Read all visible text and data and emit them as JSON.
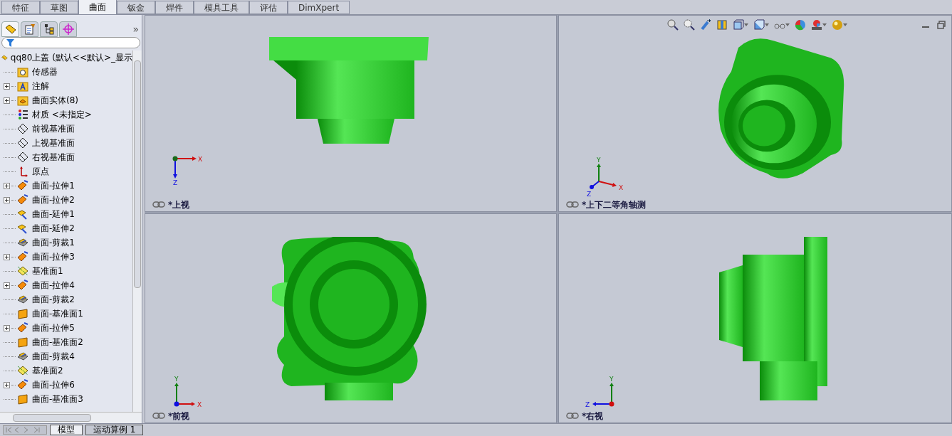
{
  "command_tabs": [
    {
      "label": "特征",
      "selected": false
    },
    {
      "label": "草图",
      "selected": false
    },
    {
      "label": "曲面",
      "selected": true
    },
    {
      "label": "钣金",
      "selected": false
    },
    {
      "label": "焊件",
      "selected": false
    },
    {
      "label": "模具工具",
      "selected": false
    },
    {
      "label": "评估",
      "selected": false
    },
    {
      "label": "DimXpert",
      "selected": false
    }
  ],
  "panel_tabs": [
    {
      "kind": "feature",
      "selected": true
    },
    {
      "kind": "property",
      "selected": false
    },
    {
      "kind": "config",
      "selected": false
    },
    {
      "kind": "target",
      "selected": false
    }
  ],
  "panel_more": "»",
  "tree": {
    "root": "qq80上盖  (默认<<默认>_显示",
    "items": [
      {
        "label": "传感器",
        "kind": "sensor",
        "expandable": false
      },
      {
        "label": "注解",
        "kind": "annotation",
        "expandable": true
      },
      {
        "label": "曲面实体(8)",
        "kind": "bodies",
        "expandable": true
      },
      {
        "label": "材质 <未指定>",
        "kind": "material",
        "expandable": false
      },
      {
        "label": "前视基准面",
        "kind": "plane",
        "expandable": false
      },
      {
        "label": "上视基准面",
        "kind": "plane",
        "expandable": false
      },
      {
        "label": "右视基准面",
        "kind": "plane",
        "expandable": false
      },
      {
        "label": "原点",
        "kind": "origin",
        "expandable": false
      },
      {
        "label": "曲面-拉伸1",
        "kind": "extrude",
        "expandable": true
      },
      {
        "label": "曲面-拉伸2",
        "kind": "extrude",
        "expandable": true
      },
      {
        "label": "曲面-延伸1",
        "kind": "extend",
        "expandable": false
      },
      {
        "label": "曲面-延伸2",
        "kind": "extend",
        "expandable": false
      },
      {
        "label": "曲面-剪裁1",
        "kind": "trim",
        "expandable": false
      },
      {
        "label": "曲面-拉伸3",
        "kind": "extrude",
        "expandable": true
      },
      {
        "label": "基准面1",
        "kind": "refplane",
        "expandable": false
      },
      {
        "label": "曲面-拉伸4",
        "kind": "extrude",
        "expandable": true
      },
      {
        "label": "曲面-剪裁2",
        "kind": "trim",
        "expandable": false
      },
      {
        "label": "曲面-基准面1",
        "kind": "planar",
        "expandable": false
      },
      {
        "label": "曲面-拉伸5",
        "kind": "extrude",
        "expandable": true
      },
      {
        "label": "曲面-基准面2",
        "kind": "planar",
        "expandable": false
      },
      {
        "label": "曲面-剪裁4",
        "kind": "trim",
        "expandable": false
      },
      {
        "label": "基准面2",
        "kind": "refplane",
        "expandable": false
      },
      {
        "label": "曲面-拉伸6",
        "kind": "extrude",
        "expandable": true
      },
      {
        "label": "曲面-基准面3",
        "kind": "planar",
        "expandable": false
      }
    ]
  },
  "bottom_tabs": [
    {
      "label": "模型",
      "selected": true
    },
    {
      "label": "运动算例 1",
      "selected": false
    }
  ],
  "viewports": [
    {
      "label": "*上视",
      "kind": "top",
      "axes": [
        "X",
        "Z"
      ]
    },
    {
      "label": "*上下二等角轴测",
      "kind": "iso",
      "axes": [
        "Y",
        "X",
        "Z"
      ]
    },
    {
      "label": "*前视",
      "kind": "front",
      "axes": [
        "Y",
        "X"
      ]
    },
    {
      "label": "*右视",
      "kind": "right",
      "axes": [
        "Y",
        "Z"
      ]
    }
  ]
}
